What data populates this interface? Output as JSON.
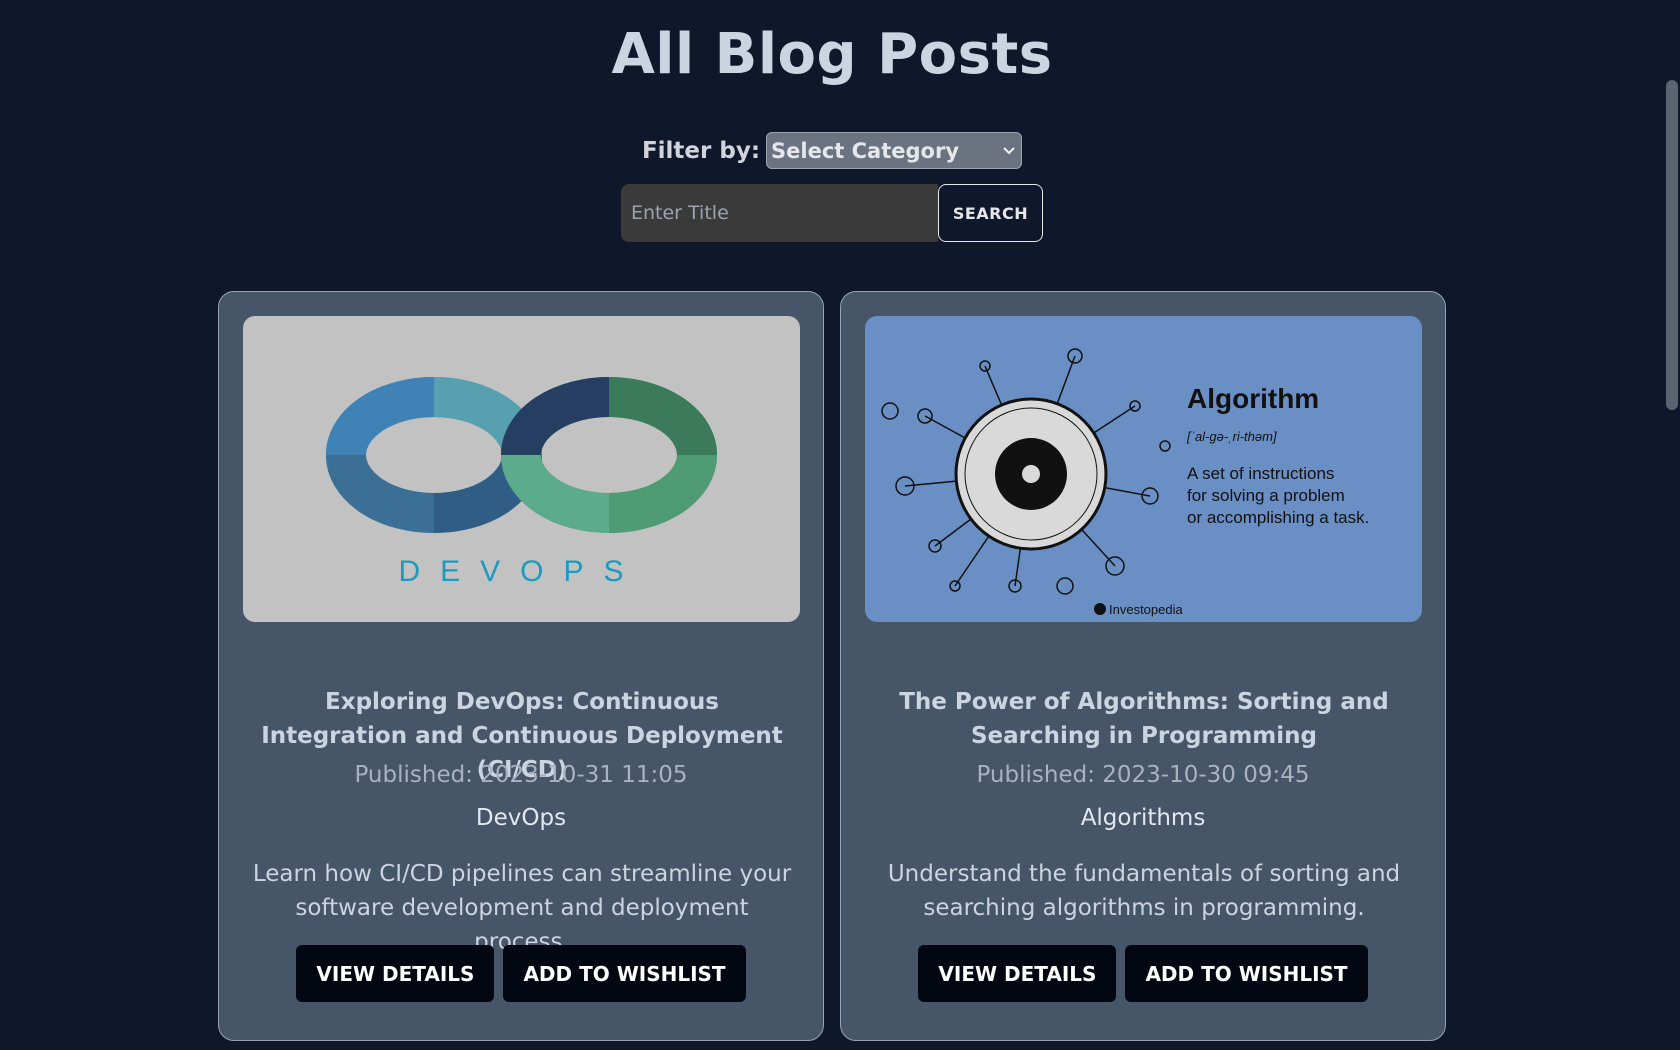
{
  "header": {
    "title": "All Blog Posts"
  },
  "filter": {
    "label": "Filter by:",
    "selected": "Select Category"
  },
  "search": {
    "placeholder": "Enter Title",
    "button_label": "SEARCH"
  },
  "posts": [
    {
      "image_icon": "devops-infinity-logo",
      "image_text": "DEVOPS",
      "title": "Exploring DevOps: Continuous Integration and Continuous Deployment (CI/CD)",
      "published": "Published: 2023-10-31 11:05",
      "category": "DevOps",
      "description": "Learn how CI/CD pipelines can streamline your software development and deployment process.",
      "view_label": "VIEW DETAILS",
      "wishlist_label": "ADD TO WISHLIST"
    },
    {
      "image_icon": "algorithm-gear-circuit",
      "image_heading": "Algorithm",
      "image_pron": "[ˈal-gə-ˌri-thəm]",
      "image_def_1": "A set of instructions",
      "image_def_2": "for solving a problem",
      "image_def_3": "or accomplishing a task.",
      "image_brand": "Investopedia",
      "title": "The Power of Algorithms: Sorting and Searching in Programming",
      "published": "Published: 2023-10-30 09:45",
      "category": "Algorithms",
      "description": "Understand the fundamentals of sorting and searching algorithms in programming.",
      "view_label": "VIEW DETAILS",
      "wishlist_label": "ADD TO WISHLIST"
    }
  ],
  "colors": {
    "background": "#0f172a",
    "card": "#475569",
    "button": "#030712"
  }
}
